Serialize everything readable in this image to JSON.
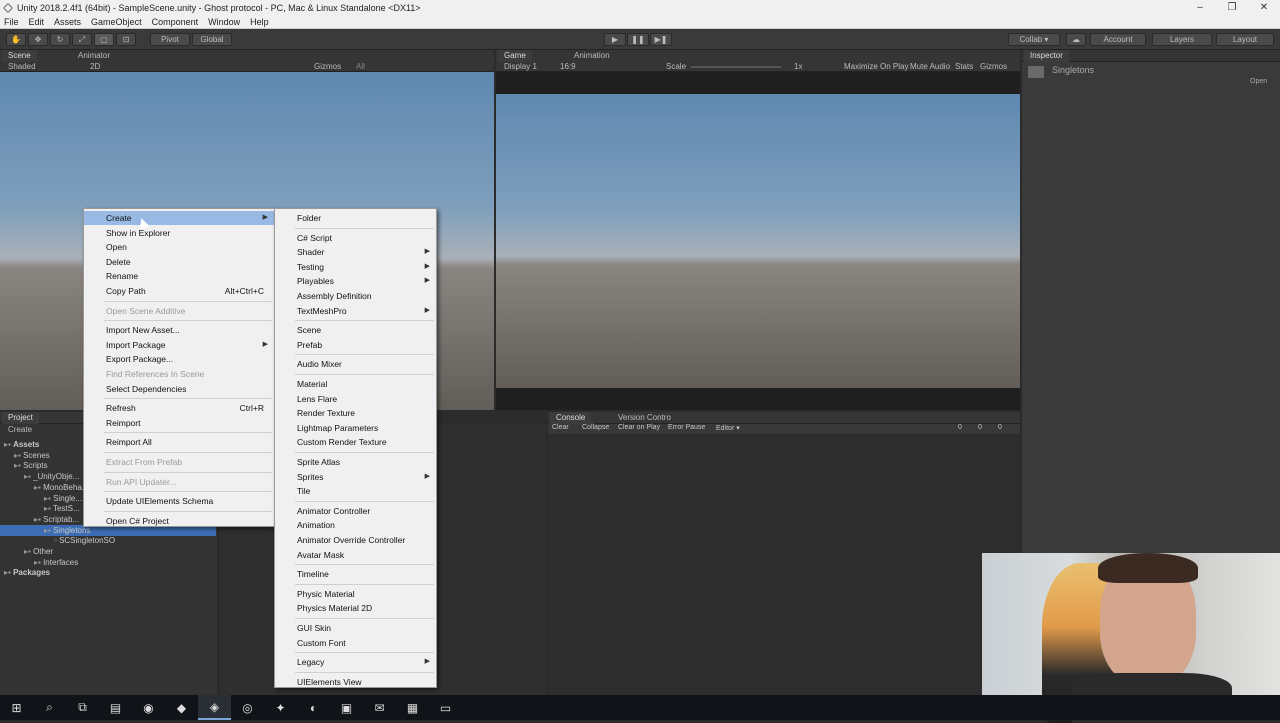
{
  "window": {
    "title": "Unity 2018.2.4f1 (64bit) - SampleScene.unity - Ghost protocol - PC, Mac & Linux Standalone <DX11>",
    "controls": [
      "–",
      "❐",
      "✕"
    ]
  },
  "menubar": [
    "File",
    "Edit",
    "Assets",
    "GameObject",
    "Component",
    "Window",
    "Help"
  ],
  "toolbar": {
    "pivot": "Pivot",
    "global": "Global",
    "collab": "Collab ▾",
    "account": "Account",
    "layers": "Layers",
    "layout": "Layout"
  },
  "scene": {
    "tabs": [
      "Scene",
      "Animator"
    ],
    "shaded": "Shaded",
    "mode2d": "2D",
    "gizmos": "Gizmos",
    "search": "All"
  },
  "game": {
    "tabs": [
      "Game",
      "Animation"
    ],
    "display": "Display 1",
    "aspect": "16:9",
    "scale_label": "Scale",
    "scale_value": "1x",
    "options": [
      "Maximize On Play",
      "Mute Audio",
      "Stats",
      "Gizmos"
    ]
  },
  "inspector": {
    "tab": "Inspector",
    "object": "Singletons",
    "open": "Open"
  },
  "project": {
    "tab": "Project",
    "create": "Create",
    "tree": [
      {
        "label": "Assets",
        "indent": 0
      },
      {
        "label": "Scenes",
        "indent": 1
      },
      {
        "label": "Scripts",
        "indent": 1
      },
      {
        "label": "_UnityObje...",
        "indent": 2
      },
      {
        "label": "MonoBeha...",
        "indent": 3
      },
      {
        "label": "Single...",
        "indent": 4
      },
      {
        "label": "TestS...",
        "indent": 4
      },
      {
        "label": "Scriptab...",
        "indent": 3
      },
      {
        "label": "Singletons",
        "indent": 4
      },
      {
        "label": "SCSingletonSO",
        "indent": 5
      },
      {
        "label": "Other",
        "indent": 2
      },
      {
        "label": "Interfaces",
        "indent": 3
      },
      {
        "label": "Packages",
        "indent": 0
      }
    ]
  },
  "console": {
    "tabs": [
      "Console",
      "Version Contro"
    ],
    "buttons": [
      "Clear",
      "Collapse",
      "Clear on Play",
      "Error Pause",
      "Editor ▾"
    ],
    "counts": [
      "0",
      "0",
      "0"
    ]
  },
  "context_menu": {
    "items": [
      {
        "label": "Create",
        "shortcut": "",
        "arrow": true,
        "disabled": false,
        "highlighted": true
      },
      {
        "label": "Show in Explorer",
        "shortcut": "",
        "arrow": false,
        "disabled": false
      },
      {
        "label": "Open",
        "shortcut": "",
        "arrow": false,
        "disabled": false
      },
      {
        "label": "Delete",
        "shortcut": "",
        "arrow": false,
        "disabled": false
      },
      {
        "label": "Rename",
        "shortcut": "",
        "arrow": false,
        "disabled": false
      },
      {
        "label": "Copy Path",
        "shortcut": "Alt+Ctrl+C",
        "arrow": false,
        "disabled": false
      },
      {
        "sep": true
      },
      {
        "label": "Open Scene Additive",
        "shortcut": "",
        "arrow": false,
        "disabled": true
      },
      {
        "sep": true
      },
      {
        "label": "Import New Asset...",
        "shortcut": "",
        "arrow": false,
        "disabled": false
      },
      {
        "label": "Import Package",
        "shortcut": "",
        "arrow": true,
        "disabled": false
      },
      {
        "label": "Export Package...",
        "shortcut": "",
        "arrow": false,
        "disabled": false
      },
      {
        "label": "Find References In Scene",
        "shortcut": "",
        "arrow": false,
        "disabled": true
      },
      {
        "label": "Select Dependencies",
        "shortcut": "",
        "arrow": false,
        "disabled": false
      },
      {
        "sep": true
      },
      {
        "label": "Refresh",
        "shortcut": "Ctrl+R",
        "arrow": false,
        "disabled": false
      },
      {
        "label": "Reimport",
        "shortcut": "",
        "arrow": false,
        "disabled": false
      },
      {
        "sep": true
      },
      {
        "label": "Reimport All",
        "shortcut": "",
        "arrow": false,
        "disabled": false
      },
      {
        "sep": true
      },
      {
        "label": "Extract From Prefab",
        "shortcut": "",
        "arrow": false,
        "disabled": true
      },
      {
        "sep": true
      },
      {
        "label": "Run API Updater...",
        "shortcut": "",
        "arrow": false,
        "disabled": true
      },
      {
        "sep": true
      },
      {
        "label": "Update UIElements Schema",
        "shortcut": "",
        "arrow": false,
        "disabled": false
      },
      {
        "sep": true
      },
      {
        "label": "Open C# Project",
        "shortcut": "",
        "arrow": false,
        "disabled": false
      }
    ]
  },
  "create_submenu": {
    "items": [
      {
        "label": "Folder",
        "arrow": false
      },
      {
        "sep": true
      },
      {
        "label": "C# Script",
        "arrow": false
      },
      {
        "label": "Shader",
        "arrow": true
      },
      {
        "label": "Testing",
        "arrow": true
      },
      {
        "label": "Playables",
        "arrow": true
      },
      {
        "label": "Assembly Definition",
        "arrow": false
      },
      {
        "label": "TextMeshPro",
        "arrow": true
      },
      {
        "sep": true
      },
      {
        "label": "Scene",
        "arrow": false
      },
      {
        "label": "Prefab",
        "arrow": false
      },
      {
        "sep": true
      },
      {
        "label": "Audio Mixer",
        "arrow": false
      },
      {
        "sep": true
      },
      {
        "label": "Material",
        "arrow": false
      },
      {
        "label": "Lens Flare",
        "arrow": false
      },
      {
        "label": "Render Texture",
        "arrow": false
      },
      {
        "label": "Lightmap Parameters",
        "arrow": false
      },
      {
        "label": "Custom Render Texture",
        "arrow": false
      },
      {
        "sep": true
      },
      {
        "label": "Sprite Atlas",
        "arrow": false
      },
      {
        "label": "Sprites",
        "arrow": true
      },
      {
        "label": "Tile",
        "arrow": false
      },
      {
        "sep": true
      },
      {
        "label": "Animator Controller",
        "arrow": false
      },
      {
        "label": "Animation",
        "arrow": false
      },
      {
        "label": "Animator Override Controller",
        "arrow": false
      },
      {
        "label": "Avatar Mask",
        "arrow": false
      },
      {
        "sep": true
      },
      {
        "label": "Timeline",
        "arrow": false
      },
      {
        "sep": true
      },
      {
        "label": "Physic Material",
        "arrow": false
      },
      {
        "label": "Physics Material 2D",
        "arrow": false
      },
      {
        "sep": true
      },
      {
        "label": "GUI Skin",
        "arrow": false
      },
      {
        "label": "Custom Font",
        "arrow": false
      },
      {
        "sep": true
      },
      {
        "label": "Legacy",
        "arrow": true
      },
      {
        "sep": true
      },
      {
        "label": "UIElements View",
        "arrow": false
      }
    ]
  },
  "taskbar": [
    "⊞",
    "⌕",
    "⧉",
    "▤",
    "◉",
    "◆",
    "◈",
    "◎",
    "✦",
    "◐",
    "▣",
    "✉",
    "▦",
    "▭"
  ],
  "colors": {
    "menu_highlight": "#99b9e5",
    "project_selection": "#3d6eb5",
    "collab_green": "#5a9a4a"
  }
}
